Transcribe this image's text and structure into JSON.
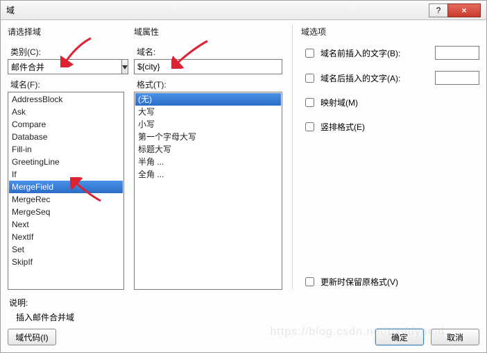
{
  "window": {
    "title": "域",
    "help_symbol": "?",
    "close_symbol": "×"
  },
  "col1": {
    "section": "请选择域",
    "category_label": "类别(C):",
    "category_value": "邮件合并",
    "fieldnames_label": "域名(F):",
    "items": [
      {
        "label": "AddressBlock",
        "selected": false
      },
      {
        "label": "Ask",
        "selected": false
      },
      {
        "label": "Compare",
        "selected": false
      },
      {
        "label": "Database",
        "selected": false
      },
      {
        "label": "Fill-in",
        "selected": false
      },
      {
        "label": "GreetingLine",
        "selected": false
      },
      {
        "label": "If",
        "selected": false
      },
      {
        "label": "MergeField",
        "selected": true
      },
      {
        "label": "MergeRec",
        "selected": false
      },
      {
        "label": "MergeSeq",
        "selected": false
      },
      {
        "label": "Next",
        "selected": false
      },
      {
        "label": "NextIf",
        "selected": false
      },
      {
        "label": "Set",
        "selected": false
      },
      {
        "label": "SkipIf",
        "selected": false
      }
    ]
  },
  "col2": {
    "section": "域属性",
    "name_label": "域名:",
    "name_value": "${city}",
    "format_label": "格式(T):",
    "formats": [
      {
        "label": "(无)",
        "selected": true
      },
      {
        "label": "大写",
        "selected": false
      },
      {
        "label": "小写",
        "selected": false
      },
      {
        "label": "第一个字母大写",
        "selected": false
      },
      {
        "label": "标题大写",
        "selected": false
      },
      {
        "label": "半角 ...",
        "selected": false
      },
      {
        "label": "全角 ...",
        "selected": false
      }
    ]
  },
  "col3": {
    "section": "域选项",
    "opt_before": "域名前插入的文字(B):",
    "opt_after": "域名后插入的文字(A):",
    "opt_mapped": "映射域(M)",
    "opt_vertical": "竖排格式(E)",
    "opt_preserve": "更新时保留原格式(V)"
  },
  "desc": {
    "label": "说明:",
    "text": "插入邮件合并域"
  },
  "buttons": {
    "fieldcodes": "域代码(I)",
    "ok": "确定",
    "cancel": "取消"
  },
  "watermark": "https://blog.csdn.net/pxddynmd"
}
